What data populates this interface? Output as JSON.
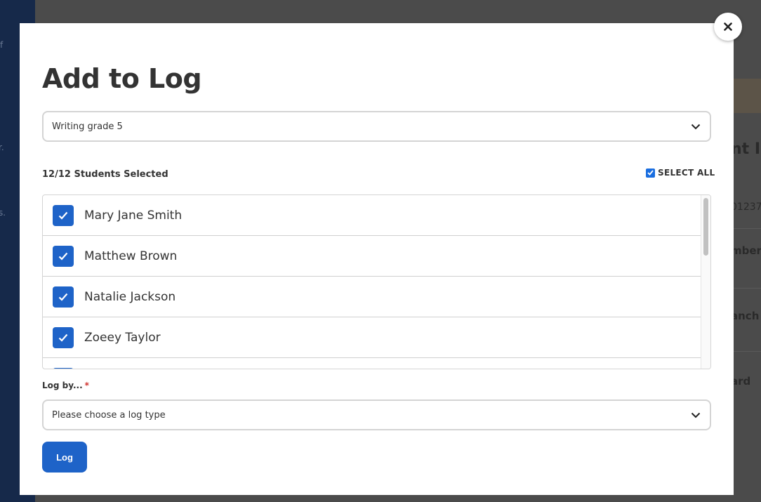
{
  "background": {
    "sidebar_fragments": [
      "f",
      "r.",
      "s."
    ],
    "right_fragments": [
      "nt In",
      "01237",
      "mber",
      "anch",
      "ard"
    ]
  },
  "modal": {
    "title": "Add to Log",
    "close_icon": "close-icon",
    "assignment_select": {
      "value": "Writing grade 5"
    },
    "students_selected": "12/12 Students Selected",
    "select_all_label": "SELECT ALL",
    "students": [
      {
        "name": "Mary Jane Smith",
        "checked": true
      },
      {
        "name": "Matthew Brown",
        "checked": true
      },
      {
        "name": "Natalie Jackson",
        "checked": true
      },
      {
        "name": "Zoeey Taylor",
        "checked": true
      },
      {
        "name": "",
        "checked": true
      }
    ],
    "log_by_label": "Log by...",
    "required_mark": "*",
    "log_type_select": {
      "placeholder": "Please choose a log type"
    },
    "log_button": "Log"
  },
  "colors": {
    "accent": "#1e63c8",
    "required": "#d0312d",
    "sidebar": "#16294a"
  }
}
